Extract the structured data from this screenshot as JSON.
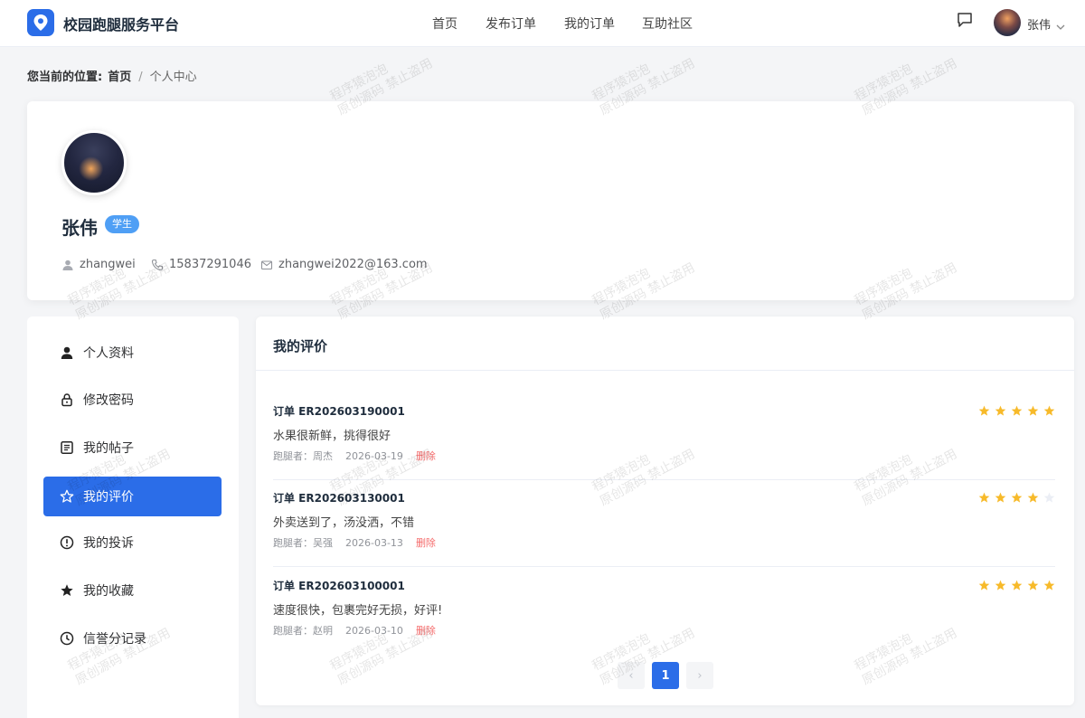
{
  "header": {
    "logo_text": "校园跑腿服务平台",
    "nav": [
      "首页",
      "发布订单",
      "我的订单",
      "互助社区"
    ],
    "user_name": "张伟"
  },
  "breadcrumb": {
    "label": "您当前的位置:",
    "home": "首页",
    "separator": "/",
    "current": "个人中心"
  },
  "profile": {
    "name": "张伟",
    "role_badge": "学生",
    "username": "zhangwei",
    "phone": "15837291046",
    "email": "zhangwei2022@163.com"
  },
  "sidebar": {
    "items": [
      {
        "label": "个人资料",
        "icon": "user-icon"
      },
      {
        "label": "修改密码",
        "icon": "lock-icon"
      },
      {
        "label": "我的帖子",
        "icon": "document-icon"
      },
      {
        "label": "我的评价",
        "icon": "star-outline-icon",
        "active": true
      },
      {
        "label": "我的投诉",
        "icon": "warning-circle-icon"
      },
      {
        "label": "我的收藏",
        "icon": "star-filled-icon"
      },
      {
        "label": "信誉分记录",
        "icon": "clock-icon"
      }
    ]
  },
  "main": {
    "title": "我的评价",
    "reviews": [
      {
        "order": "订单 ER202603190001",
        "text": "水果很新鲜，挑得很好",
        "runner": "跑腿者：周杰",
        "date": "2026-03-19",
        "delete": "删除",
        "stars": 5
      },
      {
        "order": "订单 ER202603130001",
        "text": "外卖送到了，汤没洒，不错",
        "runner": "跑腿者：吴强",
        "date": "2026-03-13",
        "delete": "删除",
        "stars": 4
      },
      {
        "order": "订单 ER202603100001",
        "text": "速度很快，包裹完好无损，好评!",
        "runner": "跑腿者：赵明",
        "date": "2026-03-10",
        "delete": "删除",
        "stars": 5
      }
    ],
    "pagination": {
      "prev": "‹",
      "current_page": "1",
      "next": "›"
    }
  },
  "watermark": {
    "line1": "程序猿泡泡",
    "line2": "原创源码 禁止盗用"
  },
  "colors": {
    "accent": "#2b6de8",
    "star": "#f7ba2a",
    "danger": "#f56c6c",
    "badge": "#4f9ff5"
  }
}
